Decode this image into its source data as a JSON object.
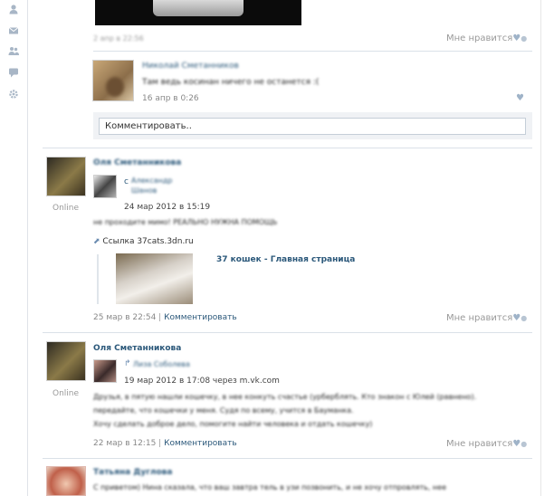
{
  "rail": {
    "icons": [
      "user-icon",
      "mail-icon",
      "friends-icon",
      "chat-icon",
      "settings-icon"
    ]
  },
  "post1": {
    "date_blur": "2 апр в 22:56",
    "like_label": "Мне нравится",
    "comment": {
      "author_blur": "Николай Сметанников",
      "text_blur": "Там ведь косинан ничего не останется :(",
      "date": "16 апр в 0:26"
    },
    "comment_placeholder": "Комментировать.."
  },
  "post2": {
    "author_blur": "Оля Сметанникова",
    "online": "Online",
    "repost": {
      "prefix": "с",
      "author_blur": "Александр Шанов",
      "date": "24 мар 2012 в 15:19"
    },
    "text_blur": "не проходите мимо! РЕАЛЬНО НУЖНА ПОМОЩЬ",
    "link_label": "Ссылка 37cats.3dn.ru",
    "link_title": "37 кошек - Главная страница",
    "date": "25 мар в 22:54",
    "separator": "|",
    "comment_link": "Комментировать",
    "like_label": "Мне нравится"
  },
  "post3": {
    "author": "Оля Сметанникова",
    "online": "Online",
    "repost": {
      "author_blur": "Лиза Соболева",
      "date": "19 мар 2012 в 17:08 через m.vk.com"
    },
    "text_blur_1": "Друзья, в пятую нашли кошечку, в нее конкуть счастье (урберблять. Кто знакон с Юлей (равнено).",
    "text_blur_2": "передайте, что кошечки у меня. Судя по всему, учится в Бауманка.",
    "text_blur_3": "Хочу сделать доброе дело, помогите найти человека и отдать кошечку)",
    "date": "22 мар в 12:15",
    "separator": "|",
    "comment_link": "Комментировать",
    "like_label": "Мне нравится"
  },
  "post4": {
    "author_blur": "Татьяна Дуглова",
    "text_blur": "С приветом) Нина сказала, что ваш завтра тель в узи позвонить, и не хочу отпровлять, нее"
  }
}
